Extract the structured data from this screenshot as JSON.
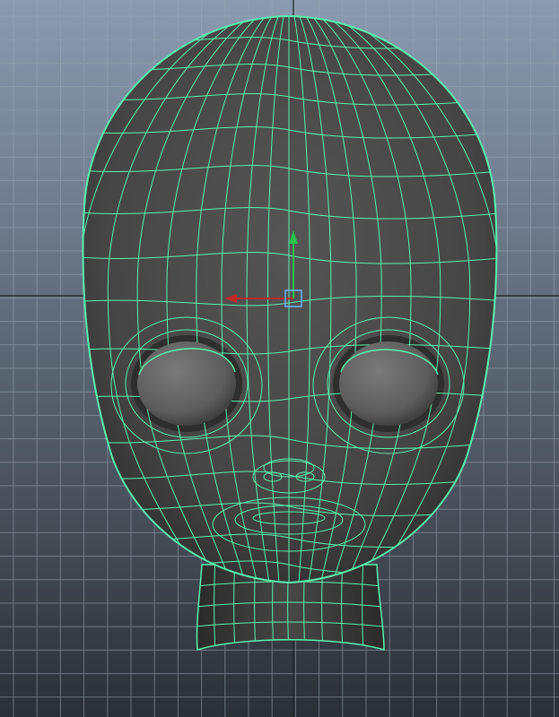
{
  "viewport": {
    "name": "perspective-viewport",
    "background_top": "#8a9bb0",
    "background_bottom": "#2b3036",
    "grid_color": "#9aa6b2",
    "axis_color": "#1e2226"
  },
  "model": {
    "name": "cartoon-head",
    "shading_color": "#4b4b4b",
    "eye_color": "#6a6a6a",
    "wireframe_color": "#5cf0b0"
  },
  "manipulator": {
    "name": "move-tool",
    "x_axis_color": "#c0282a",
    "y_axis_color": "#2dbf4c",
    "center_color": "#6fb4ff"
  }
}
